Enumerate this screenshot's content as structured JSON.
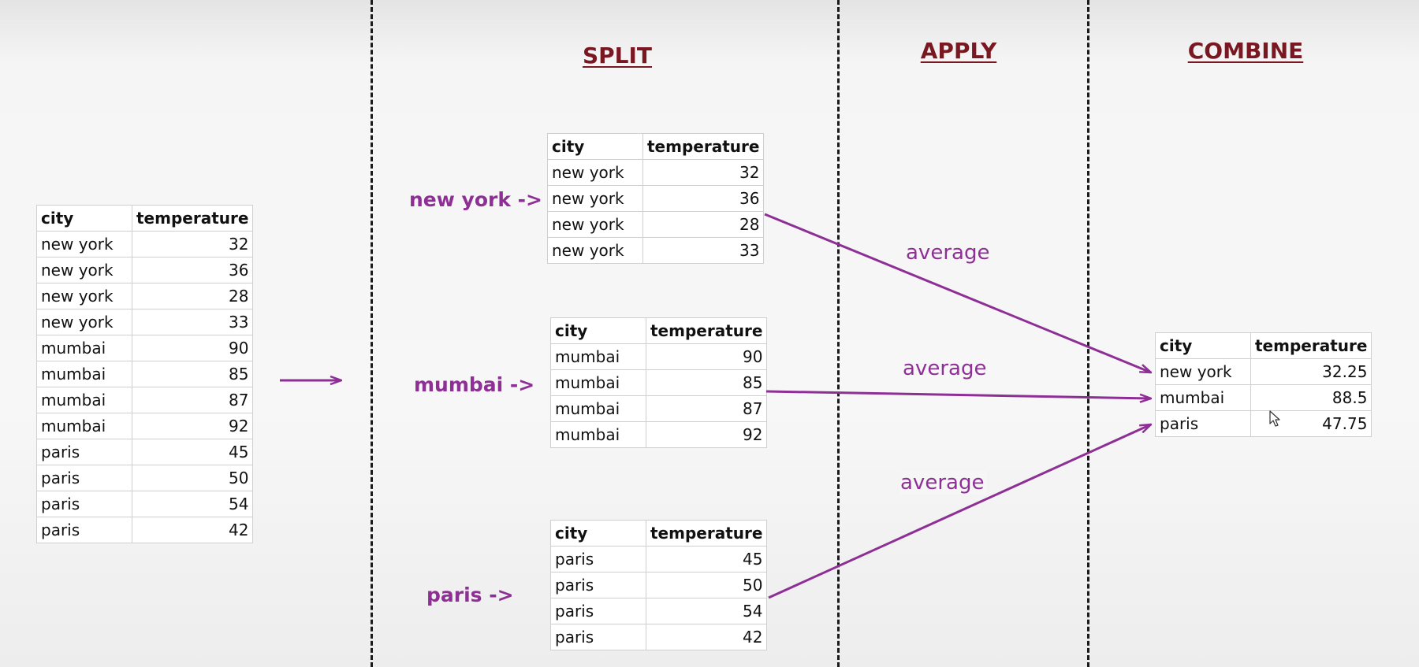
{
  "headings": {
    "split": "SPLIT",
    "apply": "APPLY",
    "combine": "COMBINE"
  },
  "columns": {
    "city": "city",
    "temperature": "temperature"
  },
  "source_table": [
    {
      "city": "new york",
      "temperature": "32"
    },
    {
      "city": "new york",
      "temperature": "36"
    },
    {
      "city": "new york",
      "temperature": "28"
    },
    {
      "city": "new york",
      "temperature": "33"
    },
    {
      "city": "mumbai",
      "temperature": "90"
    },
    {
      "city": "mumbai",
      "temperature": "85"
    },
    {
      "city": "mumbai",
      "temperature": "87"
    },
    {
      "city": "mumbai",
      "temperature": "92"
    },
    {
      "city": "paris",
      "temperature": "45"
    },
    {
      "city": "paris",
      "temperature": "50"
    },
    {
      "city": "paris",
      "temperature": "54"
    },
    {
      "city": "paris",
      "temperature": "42"
    }
  ],
  "groups": [
    {
      "label": "new york ->",
      "rows": [
        {
          "city": "new york",
          "temperature": "32"
        },
        {
          "city": "new york",
          "temperature": "36"
        },
        {
          "city": "new york",
          "temperature": "28"
        },
        {
          "city": "new york",
          "temperature": "33"
        }
      ]
    },
    {
      "label": "mumbai ->",
      "rows": [
        {
          "city": "mumbai",
          "temperature": "90"
        },
        {
          "city": "mumbai",
          "temperature": "85"
        },
        {
          "city": "mumbai",
          "temperature": "87"
        },
        {
          "city": "mumbai",
          "temperature": "92"
        }
      ]
    },
    {
      "label": "paris ->",
      "rows": [
        {
          "city": "paris",
          "temperature": "45"
        },
        {
          "city": "paris",
          "temperature": "50"
        },
        {
          "city": "paris",
          "temperature": "54"
        },
        {
          "city": "paris",
          "temperature": "42"
        }
      ]
    }
  ],
  "apply_operation": [
    "average",
    "average",
    "average"
  ],
  "result_table": [
    {
      "city": "new york",
      "temperature": "32.25"
    },
    {
      "city": "mumbai",
      "temperature": "88.5"
    },
    {
      "city": "paris",
      "temperature": "47.75"
    }
  ],
  "colors": {
    "accent": "#8e2f96",
    "heading": "#7a1822",
    "divider": "#1a1a1a"
  },
  "icons": [
    "arrow-right-icon",
    "cursor-icon"
  ]
}
